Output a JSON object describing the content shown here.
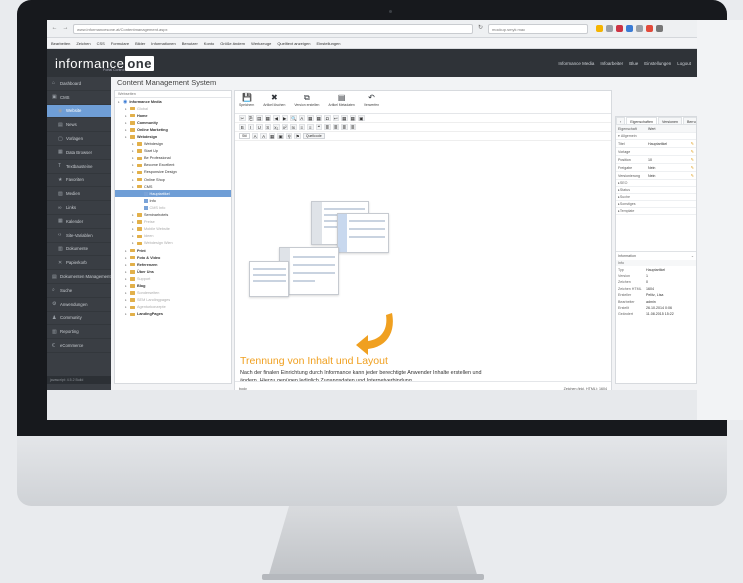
{
  "browser": {
    "url": "www.informancesone.at/Contentmanagement.aspx",
    "search": "mockup.smyk mac",
    "bookmarks": [
      "Bearbeiten",
      "Zeichen",
      "CSS",
      "Formulare",
      "Bilder",
      "Informationen",
      "Benutzer",
      "Konto",
      "Größe ändern",
      "Werkzeuge",
      "Quelltext anzeigen",
      "Einstellungen"
    ]
  },
  "app": {
    "logo_main": "informance",
    "logo_one": "one",
    "logo_sub": "Portal Control",
    "header_right": [
      "Informance Media",
      "Infoarbeiter",
      "Blue",
      "Einstellungen",
      "Logout"
    ],
    "title": "Content Management System"
  },
  "nav": {
    "items": [
      {
        "label": "Dashboard",
        "icon": "⌂"
      },
      {
        "label": "CMS",
        "icon": "▣"
      },
      {
        "label": "Website",
        "icon": "◉",
        "active": true
      },
      {
        "label": "News",
        "icon": "▤"
      },
      {
        "label": "Vorlagen",
        "icon": "▢"
      },
      {
        "label": "Data Browser",
        "icon": "▦"
      },
      {
        "label": "Textbausteine",
        "icon": "T"
      },
      {
        "label": "Favoriten",
        "icon": "★"
      },
      {
        "label": "Medien",
        "icon": "▧"
      },
      {
        "label": "Links",
        "icon": "∞"
      },
      {
        "label": "Kalender",
        "icon": "▦"
      },
      {
        "label": "Site-Variablen",
        "icon": "‹›"
      },
      {
        "label": "Dokumente",
        "icon": "▥"
      },
      {
        "label": "Papierkorb",
        "icon": "✕"
      },
      {
        "label": "Dokumenten Management",
        "icon": "▤"
      },
      {
        "label": "Suche",
        "icon": "⌕"
      },
      {
        "label": "Anwendungen",
        "icon": "⚙"
      },
      {
        "label": "Community",
        "icon": "♟"
      },
      {
        "label": "Reporting",
        "icon": "▥"
      },
      {
        "label": "eCommerce",
        "icon": "€"
      }
    ],
    "footer": "javascript: 4.5.2 Build"
  },
  "tree": {
    "header": "Webseiten",
    "items": [
      {
        "label": "Informance Media",
        "depth": 0,
        "type": "root"
      },
      {
        "label": "Global",
        "depth": 1,
        "type": "folder",
        "dim": true
      },
      {
        "label": "Home",
        "depth": 1,
        "type": "folder"
      },
      {
        "label": "Community",
        "depth": 1,
        "type": "folder"
      },
      {
        "label": "Online Marketing",
        "depth": 1,
        "type": "folder"
      },
      {
        "label": "Webdesign",
        "depth": 1,
        "type": "folder"
      },
      {
        "label": "Webdesign",
        "depth": 2,
        "type": "folder"
      },
      {
        "label": "Start Up",
        "depth": 2,
        "type": "folder"
      },
      {
        "label": "Be Professional",
        "depth": 2,
        "type": "folder"
      },
      {
        "label": "Become Excellent",
        "depth": 2,
        "type": "folder"
      },
      {
        "label": "Responsive Design",
        "depth": 2,
        "type": "folder"
      },
      {
        "label": "Online Shop",
        "depth": 2,
        "type": "folder"
      },
      {
        "label": "CMS",
        "depth": 2,
        "type": "folder"
      },
      {
        "label": "Hauptartikel",
        "depth": 3,
        "type": "page",
        "selected": true
      },
      {
        "label": "Info",
        "depth": 3,
        "type": "page"
      },
      {
        "label": "CMS Info",
        "depth": 3,
        "type": "page",
        "dim": true
      },
      {
        "label": "Seminarhotels",
        "depth": 2,
        "type": "folder"
      },
      {
        "label": "Preise",
        "depth": 2,
        "type": "folder",
        "dim": true
      },
      {
        "label": "Mobile Website",
        "depth": 2,
        "type": "folder",
        "dim": true
      },
      {
        "label": "Ideen",
        "depth": 2,
        "type": "folder",
        "dim": true
      },
      {
        "label": "Webdesign Wien",
        "depth": 2,
        "type": "folder",
        "dim": true
      },
      {
        "label": "Print",
        "depth": 1,
        "type": "folder"
      },
      {
        "label": "Foto & Video",
        "depth": 1,
        "type": "folder"
      },
      {
        "label": "Referenzen",
        "depth": 1,
        "type": "folder"
      },
      {
        "label": "Über Uns",
        "depth": 1,
        "type": "folder"
      },
      {
        "label": "Support",
        "depth": 1,
        "type": "folder",
        "dim": true
      },
      {
        "label": "Blog",
        "depth": 1,
        "type": "folder"
      },
      {
        "label": "Sonderseiten",
        "depth": 1,
        "type": "folder",
        "dim": true
      },
      {
        "label": "SEM Landingpages",
        "depth": 1,
        "type": "folder",
        "dim": true
      },
      {
        "label": "Agenturkonzepte",
        "depth": 1,
        "type": "folder",
        "dim": true
      },
      {
        "label": "LandingPages",
        "depth": 1,
        "type": "folder"
      }
    ]
  },
  "ribbon": [
    {
      "label": "Speichern",
      "icon": "💾"
    },
    {
      "label": "Artikel löschen",
      "icon": "✖"
    },
    {
      "label": "Version erstellen",
      "icon": "⧉"
    },
    {
      "label": "Artikel Metadaten",
      "icon": "▤"
    },
    {
      "label": "Verwerfen",
      "icon": "↶"
    }
  ],
  "editor": {
    "format_row1": [
      "✂",
      "⎘",
      "▤",
      "▦",
      "◀",
      "▶",
      "🔍",
      "A",
      "▦",
      "▦",
      "Ω",
      "↩",
      "▦",
      "▦",
      "▣"
    ],
    "format_row2": [
      "B",
      "I",
      "U",
      "S",
      "x₂",
      "x²",
      "Ix",
      "≡",
      "≡",
      "❝",
      "≣",
      "≣",
      "≣",
      "≣"
    ],
    "style_select": "Stil",
    "color_buttons": [
      "A",
      "A"
    ],
    "quellcode": "Quellcode",
    "headline": "Trennung von Inhalt und Layout",
    "body": "Nach der finalen Einrichtung durch Informance kann jeder berechtigte Anwender Inhalte erstellen und ändern. Hierzu genügen lediglich Zugangsdaten und Internetverbindung.",
    "status_left": "body",
    "status_right": "Zeichen (inkl. HTML): 1604"
  },
  "props": {
    "tabs": [
      "Eigenschaften",
      "Versionen",
      "Berrupa"
    ],
    "head_key": "Eigenschaft",
    "head_val": "Wert",
    "section_general": "Allgemein",
    "rows": [
      {
        "k": "Titel",
        "v": "Hauptartikel"
      },
      {
        "k": "Vorlage",
        "v": ""
      },
      {
        "k": "Position",
        "v": "10"
      },
      {
        "k": "Freigabe",
        "v": "Nein"
      },
      {
        "k": "Versionierung",
        "v": "Nein"
      }
    ],
    "sections": [
      "SEO",
      "Status",
      "Suche",
      "Sonstiges",
      "Template"
    ],
    "info_title": "Information",
    "info_head_k": "Info",
    "info": [
      {
        "k": "Typ",
        "v": "Hauptartikel"
      },
      {
        "k": "Version",
        "v": "1"
      },
      {
        "k": "Zeichen",
        "v": "0"
      },
      {
        "k": "Zeichen HTML",
        "v": "1604"
      },
      {
        "k": "Ersteller",
        "v": "Pelitz, Lisa"
      },
      {
        "k": "Bearbeiter",
        "v": "admin"
      },
      {
        "k": "Erstellt",
        "v": "26.10.2014 0:06"
      },
      {
        "k": "Geändert",
        "v": "11.08.2015 15:22"
      }
    ]
  },
  "colors": {
    "accent": "#6f9ed6",
    "headline": "#f0a020",
    "nav_bg": "#3a3e44",
    "header_bg": "#2f3338"
  }
}
